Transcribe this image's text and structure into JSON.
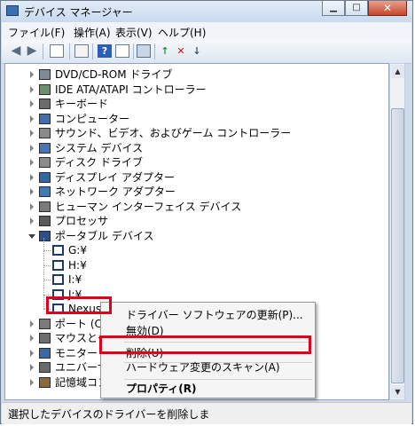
{
  "window": {
    "title": "デバイス マネージャー",
    "minimize": "▁",
    "maximize": "□",
    "close": "✕"
  },
  "menubar": [
    "ファイル(F)",
    "操作(A)",
    "表示(V)",
    "ヘルプ(H)"
  ],
  "toolbar_icons": [
    "back-arrow-icon",
    "forward-arrow-icon",
    "show-hide-console-tree-icon",
    "properties-icon",
    "help-icon",
    "show-action-pane-icon",
    "scan-hardware-icon",
    "update-driver-icon",
    "uninstall-device-icon",
    "disable-device-icon"
  ],
  "tree": [
    {
      "label": "DVD/CD-ROM ドライブ",
      "state": "collapsed",
      "icon": "dvd-drive-icon"
    },
    {
      "label": "IDE ATA/ATAPI コントローラー",
      "state": "collapsed",
      "icon": "ide-controller-icon"
    },
    {
      "label": "キーボード",
      "state": "collapsed",
      "icon": "keyboard-icon"
    },
    {
      "label": "コンピューター",
      "state": "collapsed",
      "icon": "computer-icon"
    },
    {
      "label": "サウンド、ビデオ、およびゲーム コントローラー",
      "state": "collapsed",
      "icon": "speaker-icon"
    },
    {
      "label": "システム デバイス",
      "state": "collapsed",
      "icon": "system-device-icon"
    },
    {
      "label": "ディスク ドライブ",
      "state": "collapsed",
      "icon": "disk-drive-icon"
    },
    {
      "label": "ディスプレイ アダプター",
      "state": "collapsed",
      "icon": "display-adapter-icon"
    },
    {
      "label": "ネットワーク アダプター",
      "state": "collapsed",
      "icon": "network-adapter-icon"
    },
    {
      "label": "ヒューマン インターフェイス デバイス",
      "state": "collapsed",
      "icon": "hid-icon"
    },
    {
      "label": "プロセッサ",
      "state": "collapsed",
      "icon": "processor-icon"
    },
    {
      "label": "ポータブル デバイス",
      "state": "expanded",
      "icon": "portable-device-icon"
    },
    {
      "label": "G:¥",
      "state": "child",
      "icon": "portable-device-icon"
    },
    {
      "label": "H:¥",
      "state": "child",
      "icon": "portable-device-icon"
    },
    {
      "label": "I:¥",
      "state": "child",
      "icon": "portable-device-icon"
    },
    {
      "label": "J:¥",
      "state": "child",
      "icon": "portable-device-icon"
    },
    {
      "label": "Nexus 5",
      "state": "child",
      "icon": "portable-device-icon"
    },
    {
      "label": "ポート (COM",
      "state": "collapsed",
      "icon": "port-icon"
    },
    {
      "label": "マウスとその",
      "state": "collapsed",
      "icon": "mouse-icon"
    },
    {
      "label": "モニター",
      "state": "collapsed",
      "icon": "monitor-icon"
    },
    {
      "label": "ユニバーサル",
      "state": "collapsed",
      "icon": "usb-icon"
    },
    {
      "label": "記憶域コン",
      "state": "collapsed",
      "icon": "storage-controller-icon"
    }
  ],
  "context_menu": {
    "items": [
      {
        "label": "ドライバー ソフトウェアの更新(P)...",
        "bold": false
      },
      {
        "label": "無効(D)",
        "bold": false
      },
      {
        "label": "削除(U)",
        "bold": false
      },
      {
        "label": "ハードウェア変更のスキャン(A)",
        "bold": false
      },
      {
        "label": "プロパティ(R)",
        "bold": true
      }
    ]
  },
  "status": {
    "text": "選択したデバイスのドライバーを削除しま"
  },
  "colors": {
    "highlight_box": "#e0001b",
    "titlebar": "#cfdced"
  }
}
